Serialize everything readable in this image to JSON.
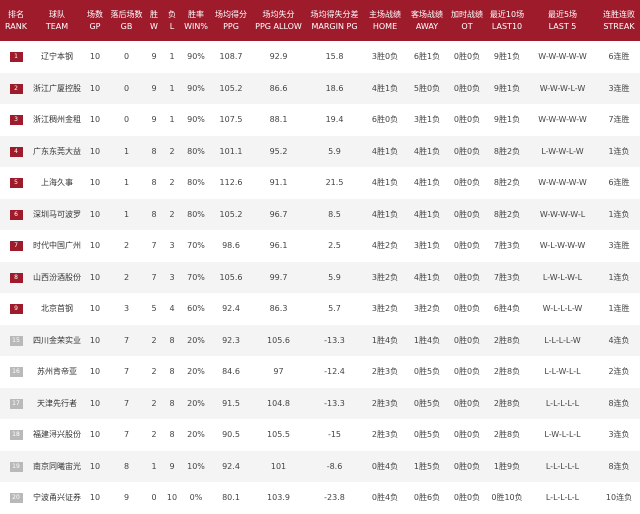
{
  "colors": {
    "header_bg": "#9e1b2c",
    "playoff_badge": "#9e1b2c",
    "other_badge": "#b9b9b9",
    "alt_row": "#f4f4f4"
  },
  "headers": [
    {
      "cn": "排名",
      "en": "RANK"
    },
    {
      "cn": "球队",
      "en": "TEAM"
    },
    {
      "cn": "场数",
      "en": "GP"
    },
    {
      "cn": "落后场数",
      "en": "GB"
    },
    {
      "cn": "胜",
      "en": "W"
    },
    {
      "cn": "负",
      "en": "L"
    },
    {
      "cn": "胜率",
      "en": "WIN%"
    },
    {
      "cn": "场均得分",
      "en": "PPG"
    },
    {
      "cn": "场均失分",
      "en": "PPG ALLOW"
    },
    {
      "cn": "场均得失分差",
      "en": "MARGIN PG"
    },
    {
      "cn": "主场战绩",
      "en": "HOME"
    },
    {
      "cn": "客场战绩",
      "en": "AWAY"
    },
    {
      "cn": "加时战绩",
      "en": "OT"
    },
    {
      "cn": "最近10场",
      "en": "LAST10"
    },
    {
      "cn": "最近5场",
      "en": "LAST 5"
    },
    {
      "cn": "连胜连败",
      "en": "STREAK"
    }
  ],
  "rows": [
    {
      "rank": "1",
      "team": "辽宁本钢",
      "gp": "10",
      "gb": "0",
      "w": "9",
      "l": "1",
      "pct": "90%",
      "ppg": "108.7",
      "opp": "92.9",
      "diff": "15.8",
      "home": "3胜0负",
      "away": "6胜1负",
      "ot": "0胜0负",
      "last10": "9胜1负",
      "last5": "W-W-W-W-W",
      "streak": "6连胜"
    },
    {
      "rank": "2",
      "team": "浙江广厦控股",
      "gp": "10",
      "gb": "0",
      "w": "9",
      "l": "1",
      "pct": "90%",
      "ppg": "105.2",
      "opp": "86.6",
      "diff": "18.6",
      "home": "4胜1负",
      "away": "5胜0负",
      "ot": "0胜0负",
      "last10": "9胜1负",
      "last5": "W-W-W-L-W",
      "streak": "3连胜"
    },
    {
      "rank": "3",
      "team": "浙江稠州金租",
      "gp": "10",
      "gb": "0",
      "w": "9",
      "l": "1",
      "pct": "90%",
      "ppg": "107.5",
      "opp": "88.1",
      "diff": "19.4",
      "home": "6胜0负",
      "away": "3胜1负",
      "ot": "0胜0负",
      "last10": "9胜1负",
      "last5": "W-W-W-W-W",
      "streak": "7连胜"
    },
    {
      "rank": "4",
      "team": "广东东莞大益",
      "gp": "10",
      "gb": "1",
      "w": "8",
      "l": "2",
      "pct": "80%",
      "ppg": "101.1",
      "opp": "95.2",
      "diff": "5.9",
      "home": "4胜1负",
      "away": "4胜1负",
      "ot": "0胜0负",
      "last10": "8胜2负",
      "last5": "L-W-W-L-W",
      "streak": "1连负"
    },
    {
      "rank": "5",
      "team": "上海久事",
      "gp": "10",
      "gb": "1",
      "w": "8",
      "l": "2",
      "pct": "80%",
      "ppg": "112.6",
      "opp": "91.1",
      "diff": "21.5",
      "home": "4胜1负",
      "away": "4胜1负",
      "ot": "0胜0负",
      "last10": "8胜2负",
      "last5": "W-W-W-W-W",
      "streak": "6连胜"
    },
    {
      "rank": "6",
      "team": "深圳马可波罗",
      "gp": "10",
      "gb": "1",
      "w": "8",
      "l": "2",
      "pct": "80%",
      "ppg": "105.2",
      "opp": "96.7",
      "diff": "8.5",
      "home": "4胜1负",
      "away": "4胜1负",
      "ot": "0胜0负",
      "last10": "8胜2负",
      "last5": "W-W-W-W-L",
      "streak": "1连负"
    },
    {
      "rank": "7",
      "team": "时代中国广州",
      "gp": "10",
      "gb": "2",
      "w": "7",
      "l": "3",
      "pct": "70%",
      "ppg": "98.6",
      "opp": "96.1",
      "diff": "2.5",
      "home": "4胜2负",
      "away": "3胜1负",
      "ot": "0胜0负",
      "last10": "7胜3负",
      "last5": "W-L-W-W-W",
      "streak": "3连胜"
    },
    {
      "rank": "8",
      "team": "山西汾酒股份",
      "gp": "10",
      "gb": "2",
      "w": "7",
      "l": "3",
      "pct": "70%",
      "ppg": "105.6",
      "opp": "99.7",
      "diff": "5.9",
      "home": "3胜2负",
      "away": "4胜1负",
      "ot": "0胜0负",
      "last10": "7胜3负",
      "last5": "L-W-L-W-L",
      "streak": "1连负"
    },
    {
      "rank": "9",
      "team": "北京首钢",
      "gp": "10",
      "gb": "3",
      "w": "5",
      "l": "4",
      "pct": "60%",
      "ppg": "92.4",
      "opp": "86.3",
      "diff": "5.7",
      "home": "3胜2负",
      "away": "3胜2负",
      "ot": "0胜0负",
      "last10": "6胜4负",
      "last5": "W-L-L-L-W",
      "streak": "1连胜"
    },
    {
      "rank": "15",
      "team": "四川金荣实业",
      "gp": "10",
      "gb": "7",
      "w": "2",
      "l": "8",
      "pct": "20%",
      "ppg": "92.3",
      "opp": "105.6",
      "diff": "-13.3",
      "home": "1胜4负",
      "away": "1胜4负",
      "ot": "0胜0负",
      "last10": "2胜8负",
      "last5": "L-L-L-L-W",
      "streak": "4连负"
    },
    {
      "rank": "16",
      "team": "苏州肯帝亚",
      "gp": "10",
      "gb": "7",
      "w": "2",
      "l": "8",
      "pct": "20%",
      "ppg": "84.6",
      "opp": "97",
      "diff": "-12.4",
      "home": "2胜3负",
      "away": "0胜5负",
      "ot": "0胜0负",
      "last10": "2胜8负",
      "last5": "L-L-W-L-L",
      "streak": "2连负"
    },
    {
      "rank": "17",
      "team": "天津先行者",
      "gp": "10",
      "gb": "7",
      "w": "2",
      "l": "8",
      "pct": "20%",
      "ppg": "91.5",
      "opp": "104.8",
      "diff": "-13.3",
      "home": "2胜3负",
      "away": "0胜5负",
      "ot": "0胜0负",
      "last10": "2胜8负",
      "last5": "L-L-L-L-L",
      "streak": "8连负"
    },
    {
      "rank": "18",
      "team": "福建浔兴股份",
      "gp": "10",
      "gb": "7",
      "w": "2",
      "l": "8",
      "pct": "20%",
      "ppg": "90.5",
      "opp": "105.5",
      "diff": "-15",
      "home": "2胜3负",
      "away": "0胜5负",
      "ot": "0胜0负",
      "last10": "2胜8负",
      "last5": "L-W-L-L-L",
      "streak": "3连负"
    },
    {
      "rank": "19",
      "team": "南京同曦宙光",
      "gp": "10",
      "gb": "8",
      "w": "1",
      "l": "9",
      "pct": "10%",
      "ppg": "92.4",
      "opp": "101",
      "diff": "-8.6",
      "home": "0胜4负",
      "away": "1胜5负",
      "ot": "0胜0负",
      "last10": "1胜9负",
      "last5": "L-L-L-L-L",
      "streak": "8连负"
    },
    {
      "rank": "20",
      "team": "宁波甬兴证券",
      "gp": "10",
      "gb": "9",
      "w": "0",
      "l": "10",
      "pct": "0%",
      "ppg": "80.1",
      "opp": "103.9",
      "diff": "-23.8",
      "home": "0胜4负",
      "away": "0胜6负",
      "ot": "0胜0负",
      "last10": "0胜10负",
      "last5": "L-L-L-L-L",
      "streak": "10连负"
    }
  ]
}
